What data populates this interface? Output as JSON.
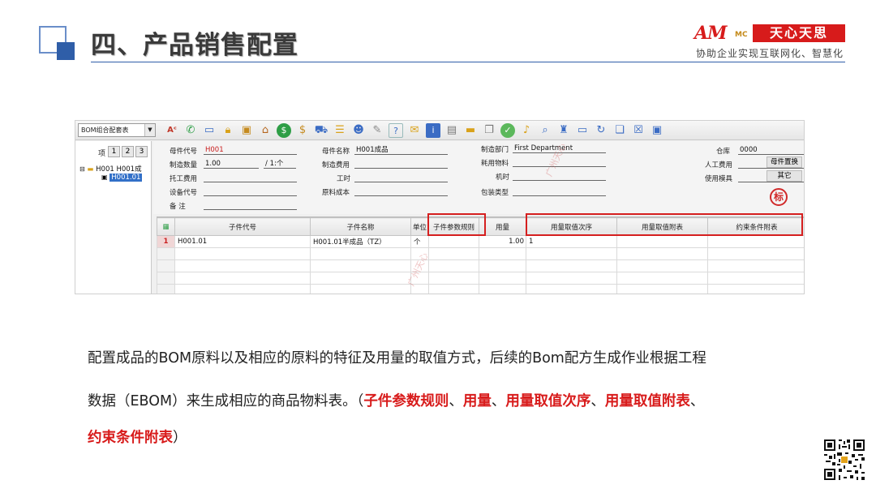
{
  "slide": {
    "title": "四、产品销售配置",
    "logo_mark": "AM",
    "logo_sub": "MC",
    "logo_text": "天心天思",
    "tagline": "协助企业实现互联网化、智慧化"
  },
  "app": {
    "combo_value": "BOM组合配套表",
    "toolbar_icons": [
      "abc-icon",
      "phone-icon",
      "monitor-icon",
      "lock-icon",
      "briefcase-icon",
      "home-icon",
      "dollar-icon",
      "moneybag-icon",
      "cart-icon",
      "clipboard-icon",
      "people-icon",
      "wrench-icon",
      "help-icon",
      "mail-icon",
      "info-icon",
      "document-icon",
      "folder-icon",
      "copy-icon",
      "check-icon",
      "bell-icon",
      "search-icon",
      "org-icon",
      "screen-icon",
      "refresh-icon",
      "window-icon",
      "close-icon",
      "save-icon"
    ],
    "tree": {
      "header": "项",
      "levels": [
        "1",
        "2",
        "3"
      ],
      "node1": "H001  H001成",
      "node2": "H001.01"
    },
    "form": {
      "parent_code_label": "母件代号",
      "parent_code": "H001",
      "parent_name_label": "母件名称",
      "parent_name": "H001成品",
      "dept_label": "制造部门",
      "dept": "First Department",
      "warehouse_label": "仓库",
      "warehouse": "0000",
      "qty_label": "制造数量",
      "qty": "1.00",
      "unit": "/ 1:个",
      "mfg_cost_label": "制造费用",
      "consumables_label": "耗用物料",
      "labor_label": "人工费用",
      "outsource_label": "托工费用",
      "hours_label": "工时",
      "machine_label": "机时",
      "mold_label": "使用模具",
      "equip_label": "设备代号",
      "material_cost_label": "原料成本",
      "package_label": "包装类型",
      "note_label": "备    注",
      "side_btn1": "母件置换",
      "side_btn2": "其它",
      "stamp": "标"
    },
    "grid": {
      "headers": [
        "子件代号",
        "子件名称",
        "单位",
        "子件参数规则",
        "用量",
        "用量取值次序",
        "用量取值附表",
        "约束条件附表"
      ],
      "rows": [
        {
          "no": "1",
          "code": "H001.01",
          "name": "H001.01半成品（TZ）",
          "unit": "个",
          "rule": "",
          "qty": "1.00",
          "order": "1",
          "table": "",
          "constraint": ""
        }
      ]
    },
    "watermark": "广州天心"
  },
  "description": {
    "line1": "配置成品的BOM原料以及相应的原料的特征及用量的取值方式，后续的Bom配方生成作业根据工程",
    "line2_pre": "数据（EBOM）来生成相应的商品物料表。（",
    "line2_hl1": "子件参数规则",
    "sep": "、",
    "line2_hl2": "用量",
    "line2_hl3": "用量取值次序",
    "line2_hl4": "用量取值附表",
    "line3_hl5": "约束条件附表",
    "line3_post": "）"
  },
  "colors": {
    "accent": "#2f5ea8",
    "highlight_red": "#d81b1b"
  }
}
